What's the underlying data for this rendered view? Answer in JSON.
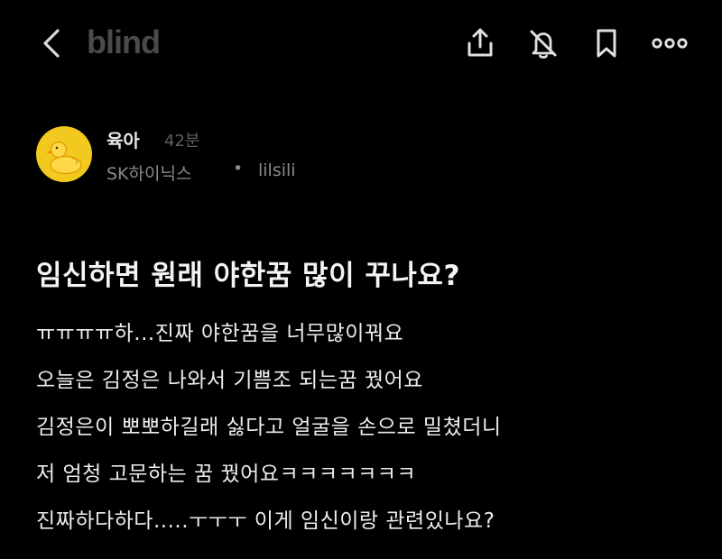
{
  "header": {
    "logo_text": "blind",
    "icons": [
      "back-chevron-icon",
      "share-icon",
      "notification-off-icon",
      "bookmark-icon",
      "more-icon"
    ]
  },
  "author": {
    "category": "육아",
    "time": "42분",
    "company": "SK하이닉스",
    "separator": "•",
    "nickname": "lilsili"
  },
  "post": {
    "title": "임신하면 원래 야한꿈 많이 꾸나요?",
    "lines": [
      "ㅠㅠㅠㅠ하...진짜 야한꿈을 너무많이꿔요",
      "오늘은 김정은 나와서 기쁨조 되는꿈 꿨어요",
      "김정은이 뽀뽀하길래 싫다고 얼굴을 손으로 밀쳤더니",
      "저 엄청 고문하는 꿈 꿨어요ㅋㅋㅋㅋㅋㅋㅋ",
      "진짜하다하다.....ㅜㅜㅜ 이게 임신이랑 관련있나요?"
    ]
  },
  "colors": {
    "background": "#000000",
    "logo": "#4a4a4a",
    "avatar": "#f2c91f",
    "muted_text": "#8a8a8a"
  }
}
